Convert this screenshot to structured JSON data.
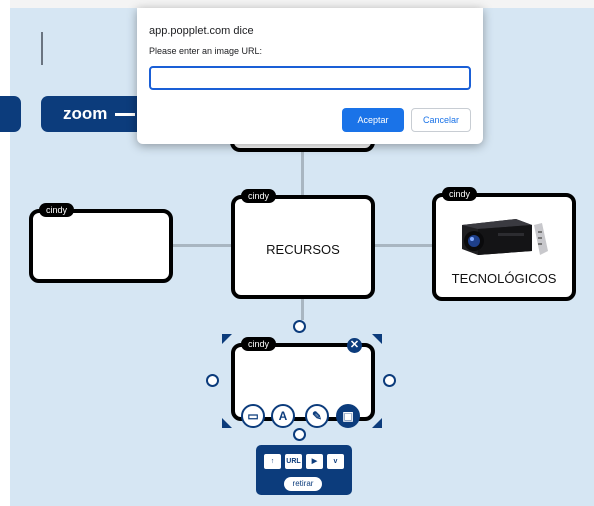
{
  "toolbar": {
    "zoom_label": "zoom"
  },
  "popples": {
    "top": {
      "author": ""
    },
    "left": {
      "author": "cindy",
      "text": ""
    },
    "center": {
      "author": "cindy",
      "text": "RECURSOS"
    },
    "right": {
      "author": "cindy",
      "text": "TECNOLÓGICOS",
      "image": "projector"
    },
    "editing": {
      "author": "cindy",
      "text": ""
    }
  },
  "edit_tools": [
    {
      "icon": "comment-icon",
      "glyph": "▭"
    },
    {
      "icon": "text-icon",
      "glyph": "A"
    },
    {
      "icon": "pencil-icon",
      "glyph": "✎"
    },
    {
      "icon": "image-icon",
      "glyph": "▣"
    }
  ],
  "media_panel": {
    "upload_icon": "upload-icon",
    "url_label": "URL",
    "youtube_icon": "youtube-icon",
    "vimeo_label": "v",
    "retirar_label": "retirar"
  },
  "dialog": {
    "title": "app.popplet.com dice",
    "message": "Please enter an image URL:",
    "input_value": "",
    "ok_label": "Aceptar",
    "cancel_label": "Cancelar"
  },
  "colors": {
    "canvas": "#d6e6f3",
    "navy": "#0c3c7c",
    "popple_border": "#000000",
    "dialog_primary": "#1a73e8"
  }
}
